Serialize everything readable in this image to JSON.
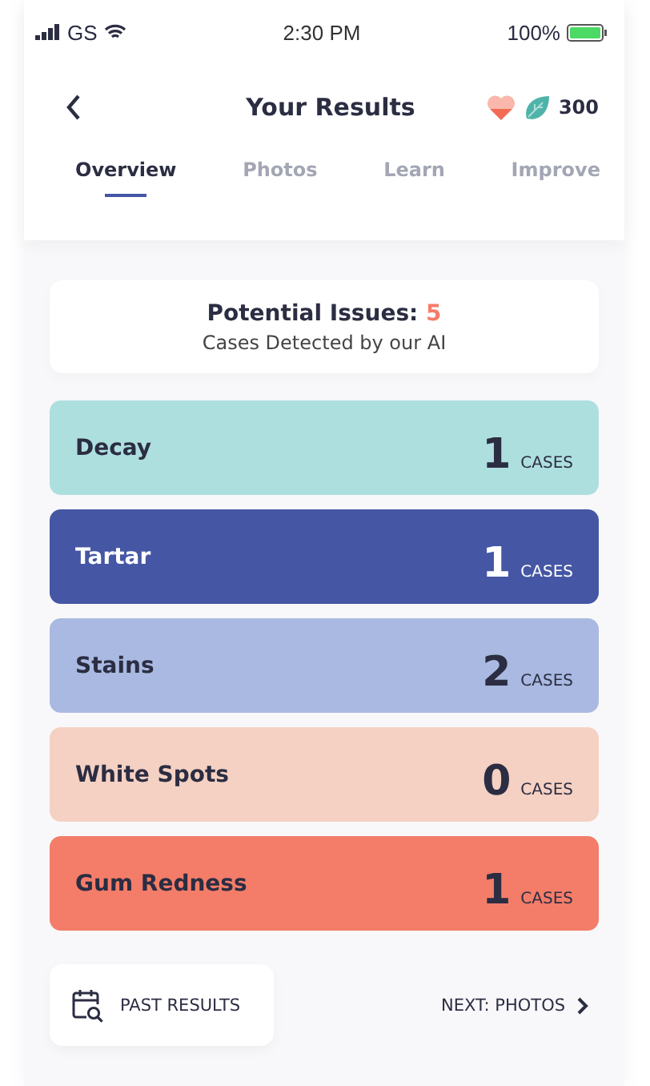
{
  "status_bar": {
    "carrier": "GS",
    "time": "2:30 PM",
    "battery": "100%"
  },
  "header": {
    "title": "Your Results",
    "points": "300"
  },
  "tabs": [
    {
      "label": "Overview",
      "selected": true
    },
    {
      "label": "Photos",
      "selected": false
    },
    {
      "label": "Learn",
      "selected": false
    },
    {
      "label": "Improve",
      "selected": false
    }
  ],
  "summary": {
    "label": "Potential Issues:",
    "count": "5",
    "subtitle": "Cases Detected by our AI"
  },
  "issues": [
    {
      "name": "Decay",
      "count": "1",
      "unit": "CASES",
      "color": "#aedfdf"
    },
    {
      "name": "Tartar",
      "count": "1",
      "unit": "CASES",
      "color": "#4556a4"
    },
    {
      "name": "Stains",
      "count": "2",
      "unit": "CASES",
      "color": "#a9b9e1"
    },
    {
      "name": "White Spots",
      "count": "0",
      "unit": "CASES",
      "color": "#f5d1c3"
    },
    {
      "name": "Gum Redness",
      "count": "1",
      "unit": "CASES",
      "color": "#f47d69"
    }
  ],
  "footer": {
    "past_button": "PAST RESULTS",
    "next_link": "NEXT: PHOTOS"
  }
}
